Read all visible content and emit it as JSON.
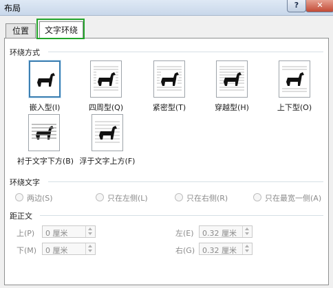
{
  "window": {
    "title": "布局",
    "help_glyph": "?",
    "close_glyph": "✕"
  },
  "tabs": [
    {
      "label": "位置"
    },
    {
      "label": "文字环绕"
    }
  ],
  "wrap_style": {
    "section_title": "环绕方式",
    "options": [
      {
        "label": "嵌入型(I)",
        "selected": true
      },
      {
        "label": "四周型(Q)",
        "selected": false
      },
      {
        "label": "紧密型(T)",
        "selected": false
      },
      {
        "label": "穿越型(H)",
        "selected": false
      },
      {
        "label": "上下型(O)",
        "selected": false
      },
      {
        "label": "衬于文字下方(B)",
        "selected": false
      },
      {
        "label": "浮于文字上方(F)",
        "selected": false
      }
    ]
  },
  "wrap_text": {
    "section_title": "环绕文字",
    "options": [
      {
        "label": "两边(S)"
      },
      {
        "label": "只在左侧(L)"
      },
      {
        "label": "只在右侧(R)"
      },
      {
        "label": "只在最宽一侧(A)"
      }
    ]
  },
  "distance": {
    "section_title": "距正文",
    "top": {
      "label": "上(P)",
      "value": "0 厘米"
    },
    "bottom": {
      "label": "下(M)",
      "value": "0 厘米"
    },
    "left": {
      "label": "左(E)",
      "value": "0.32 厘米"
    },
    "right": {
      "label": "右(G)",
      "value": "0.32 厘米"
    }
  },
  "colors": {
    "tab_highlight": "#22a32a",
    "selected_border": "#3c7fb1"
  }
}
